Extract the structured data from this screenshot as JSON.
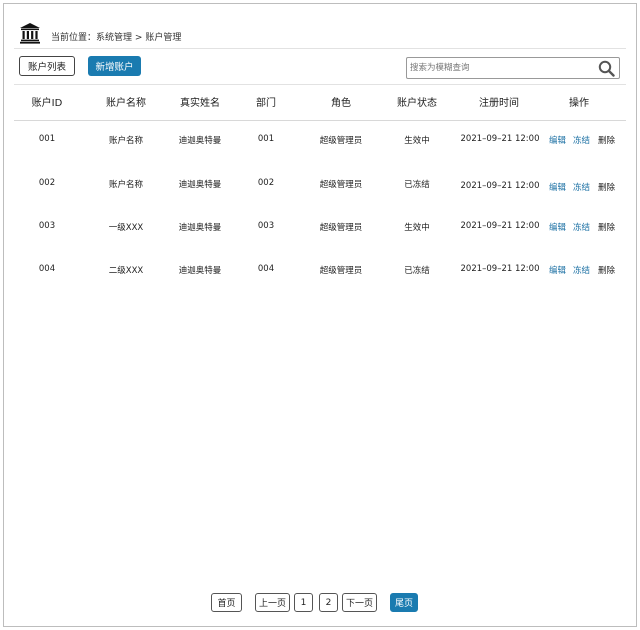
{
  "header": {
    "icon": "bank-building-icon",
    "breadcrumb_prefix": "当前位置：",
    "breadcrumb_section": "系统管理",
    "breadcrumb_sep": ">",
    "breadcrumb_page": "账户管理"
  },
  "toolbar": {
    "list_label": "账户列表",
    "add_label": "新增账户",
    "accent_color": "#1a7bb0"
  },
  "search": {
    "placeholder": "搜索为模糊查询",
    "icon": "search-icon"
  },
  "table": {
    "columns": [
      "账户ID",
      "账户名称",
      "真实姓名",
      "部门",
      "角色",
      "账户状态",
      "注册时间",
      "操作"
    ],
    "rows": [
      {
        "id": "001",
        "name": "账户名称",
        "real_name": "迪迦奥特曼",
        "dept": "001",
        "role": "超级管理员",
        "status": "生效中",
        "registered": "2021–09–21 12:00",
        "edit": "编辑",
        "freeze": "冻结",
        "delete": "删除"
      },
      {
        "id": "002",
        "name": "账户名称",
        "real_name": "迪迦奥特曼",
        "dept": "002",
        "role": "超级管理员",
        "status": "已冻结",
        "registered": "2021–09–21 12:00",
        "edit": "编辑",
        "freeze": "冻结",
        "delete": "删除"
      },
      {
        "id": "003",
        "name": "一级XXX",
        "real_name": "迪迦奥特曼",
        "dept": "003",
        "role": "超级管理员",
        "status": "生效中",
        "registered": "2021–09–21 12:00",
        "edit": "编辑",
        "freeze": "冻结",
        "delete": "删除"
      },
      {
        "id": "004",
        "name": "二级XXX",
        "real_name": "迪迦奥特曼",
        "dept": "004",
        "role": "超级管理员",
        "status": "已冻结",
        "registered": "2021–09–21 12:00",
        "edit": "编辑",
        "freeze": "冻结",
        "delete": "删除"
      }
    ]
  },
  "pagination": {
    "first": "首页",
    "prev": "上一页",
    "pages": [
      "1",
      "2"
    ],
    "next": "下一页",
    "last": "尾页"
  }
}
